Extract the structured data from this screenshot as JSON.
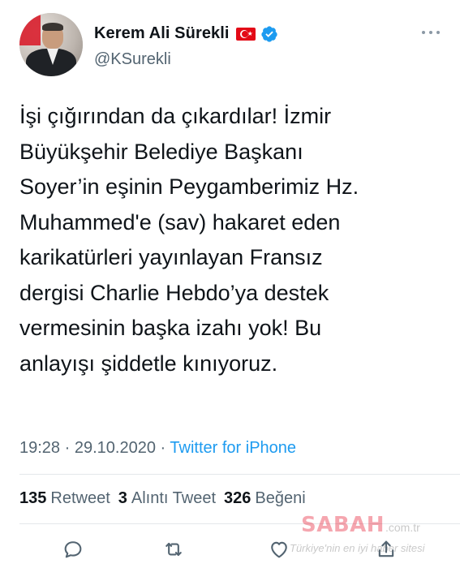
{
  "author": {
    "display_name": "Kerem Ali Sürekli",
    "handle": "@KSurekli",
    "flag_icon": "turkey-flag-icon",
    "verified_icon": "verified-badge-icon"
  },
  "tweet": {
    "text": "İşi çığırından da çıkardılar! İzmir\nBüyükşehir Belediye Başkanı\nSoyer’in eşinin Peygamberimiz Hz.\nMuhammed'e (sav) hakaret eden\nkarikatürleri yayınlayan Fransız\ndergisi Charlie Hebdo’ya destek\nvermesinin başka izahı yok! Bu\nanlayışı şiddetle kınıyoruz.",
    "time": "19:28",
    "separator": "·",
    "date": "29.10.2020",
    "source": "Twitter for iPhone"
  },
  "stats": {
    "retweets_count": "135",
    "retweets_label": "Retweet",
    "quotes_count": "3",
    "quotes_label": "Alıntı Tweet",
    "likes_count": "326",
    "likes_label": "Beğeni"
  },
  "watermark": {
    "logo": "SABAH",
    "domain": ".com.tr",
    "slogan": "Türkiye'nin en iyi haber sitesi"
  },
  "colors": {
    "link_blue": "#1d9bf0",
    "muted_gray": "#536471",
    "text": "#0f1419",
    "turkey_red": "#e30a17"
  }
}
